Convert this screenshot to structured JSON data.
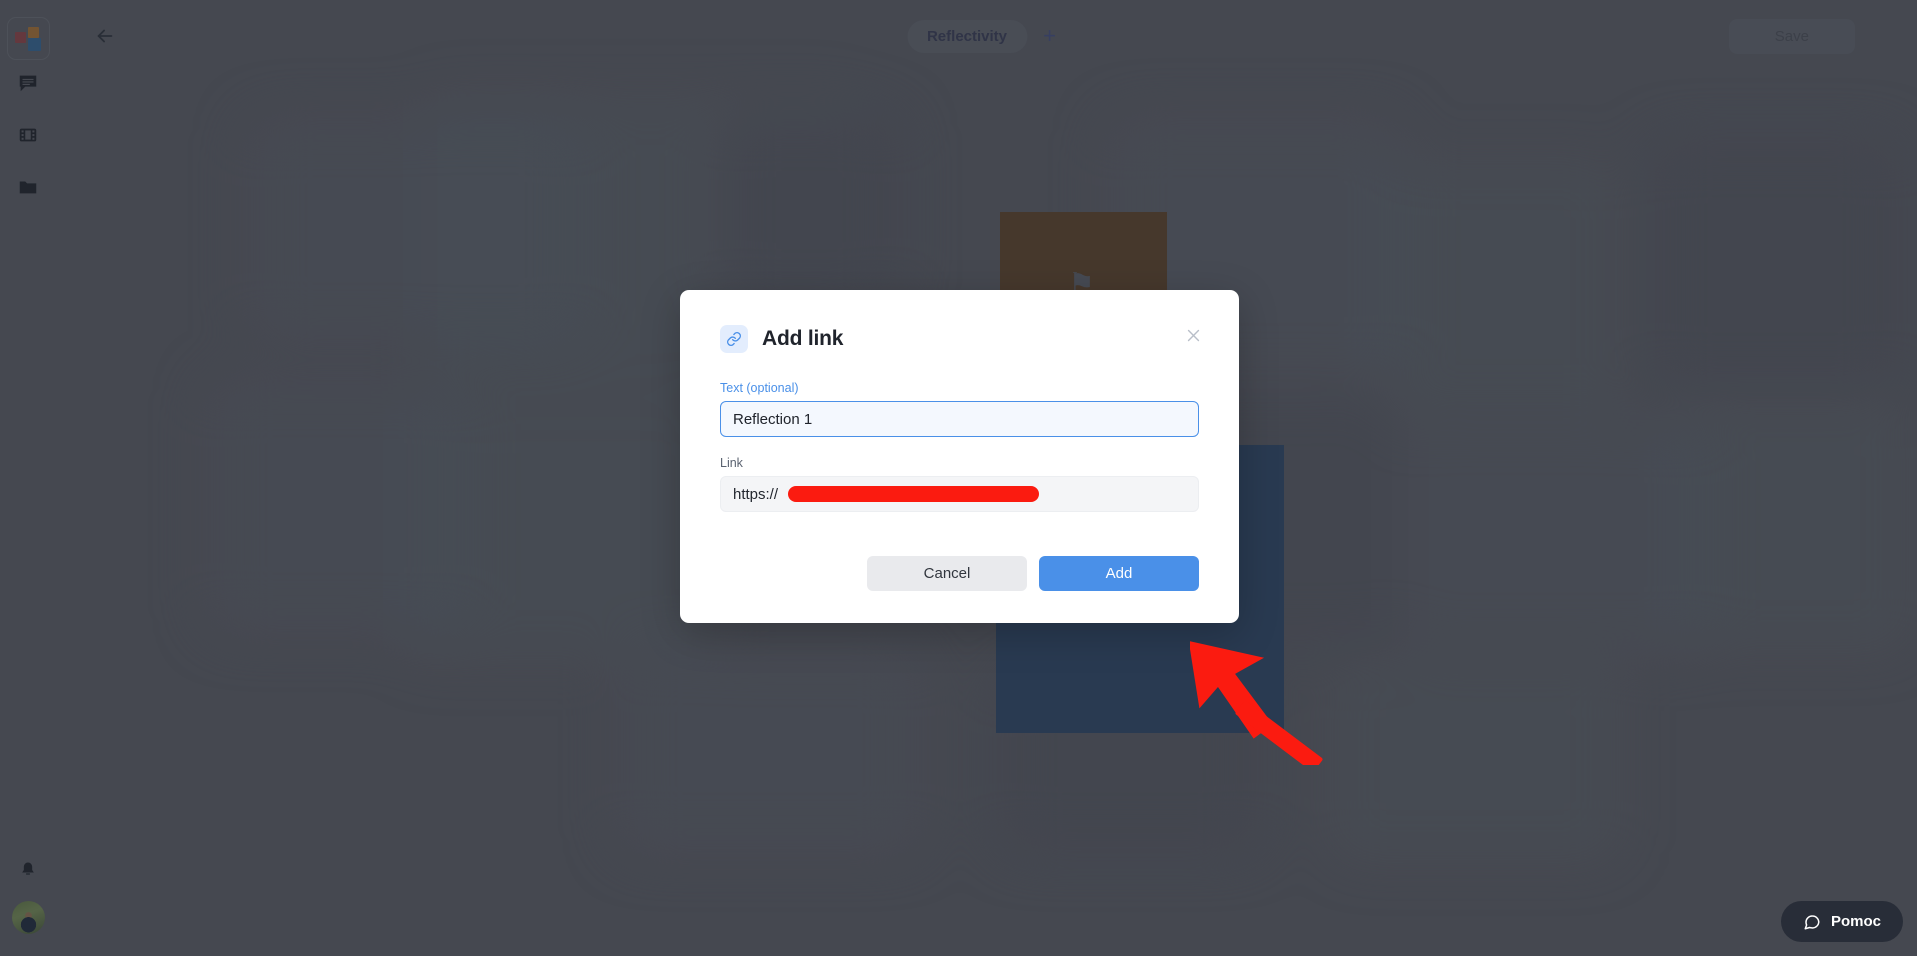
{
  "app": {
    "background_color": "#494d55",
    "accent_color": "#4a90e8"
  },
  "sidebar": {
    "logo_name": "app-logo",
    "items": [
      {
        "icon": "comment-icon",
        "name": "sidebar-item-comments"
      },
      {
        "icon": "film-strip-icon",
        "name": "sidebar-item-media"
      },
      {
        "icon": "folder-icon",
        "name": "sidebar-item-files"
      }
    ],
    "bell_icon": "bell-icon",
    "avatar_name": "user-avatar"
  },
  "topbar": {
    "back_label": "back-arrow-icon",
    "tabs": [
      {
        "label": "Reflectivity",
        "active": true
      }
    ],
    "add_tab_label": "+",
    "save_label": "Save"
  },
  "modal": {
    "title": "Add link",
    "icon": "link-icon",
    "close_label": "×",
    "text_field": {
      "label": "Text (optional)",
      "value": "Reflection 1",
      "placeholder": ""
    },
    "link_field": {
      "label": "Link",
      "value": "https://",
      "redacted": true
    },
    "cancel_label": "Cancel",
    "add_label": "Add"
  },
  "help": {
    "label": "Pomoc",
    "icon": "speech-bubble-icon"
  },
  "annotation": {
    "arrow_color": "#fb1b10",
    "points_at": "add-button"
  }
}
